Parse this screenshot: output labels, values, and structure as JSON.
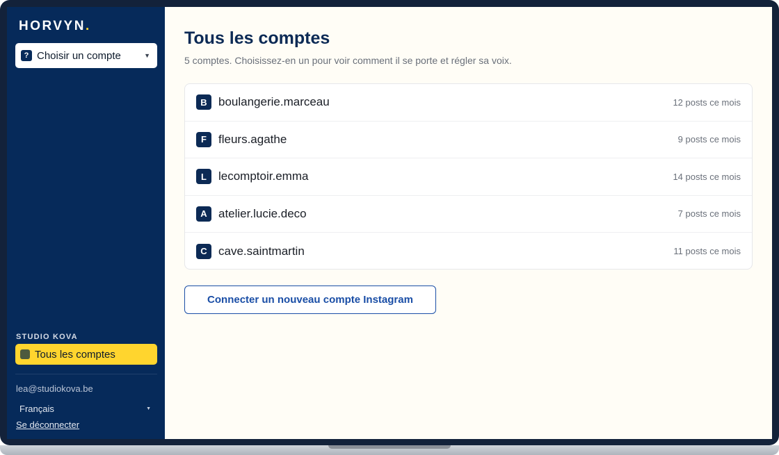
{
  "app": {
    "logo_text": "HORVYN",
    "logo_dot": ".",
    "brand_color": "#062a5a",
    "accent_color": "#ffd52e"
  },
  "sidebar": {
    "account_select": {
      "badge": "?",
      "label": "Choisir un compte",
      "caret_icon": "chevron-down-icon"
    },
    "workspace_title": "STUDIO KOVA",
    "nav_items": [
      {
        "label": "Tous les comptes",
        "active": true,
        "icon": "square-icon"
      }
    ],
    "user_email": "lea@studiokova.be",
    "language": "Français",
    "logout_label": "Se déconnecter"
  },
  "main": {
    "title": "Tous les comptes",
    "subtitle": "5 comptes. Choisissez-en un pour voir comment il se porte et régler sa voix.",
    "accounts": [
      {
        "initial": "B",
        "handle": "boulangerie.marceau",
        "stats": "12 posts ce mois"
      },
      {
        "initial": "F",
        "handle": "fleurs.agathe",
        "stats": "9 posts ce mois"
      },
      {
        "initial": "L",
        "handle": "lecomptoir.emma",
        "stats": "14 posts ce mois"
      },
      {
        "initial": "A",
        "handle": "atelier.lucie.deco",
        "stats": "7 posts ce mois"
      },
      {
        "initial": "C",
        "handle": "cave.saintmartin",
        "stats": "11 posts ce mois"
      }
    ],
    "connect_button_label": "Connecter un nouveau compte Instagram"
  }
}
